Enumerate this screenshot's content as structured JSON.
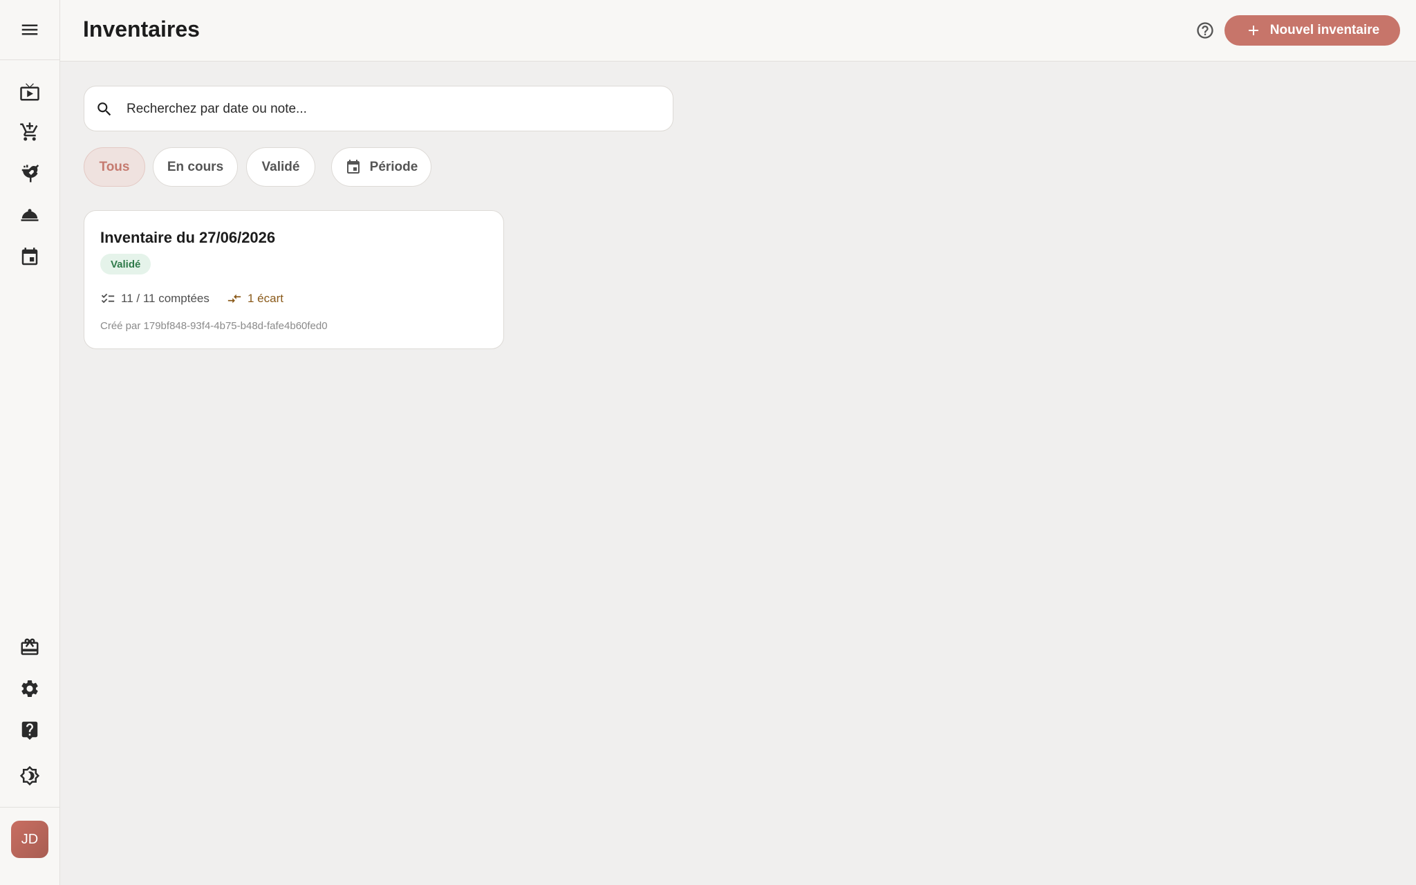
{
  "header": {
    "title": "Inventaires",
    "new_button_label": "Nouvel inventaire"
  },
  "search": {
    "placeholder": "Recherchez par date ou note..."
  },
  "filters": [
    {
      "label": "Tous",
      "active": true
    },
    {
      "label": "En cours",
      "active": false
    },
    {
      "label": "Validé",
      "active": false
    },
    {
      "label": "Période",
      "active": false,
      "icon": "calendar-icon"
    }
  ],
  "sidebar": {
    "menu_icon": "menu-icon",
    "items": [
      {
        "icon": "live-tv-icon"
      },
      {
        "icon": "add-to-cart-icon"
      },
      {
        "icon": "soup-kitchen-icon"
      },
      {
        "icon": "room-service-icon"
      },
      {
        "icon": "event-icon"
      }
    ],
    "bottom_items": [
      {
        "icon": "register-icon"
      },
      {
        "icon": "gear-icon"
      },
      {
        "icon": "help-center-icon"
      },
      {
        "icon": "brightness-icon"
      }
    ],
    "user": {
      "initials": "JD"
    }
  },
  "inventories": [
    {
      "title": "Inventaire du 27/06/2026",
      "status": "Validé",
      "counted": "11 / 11 comptées",
      "gaps": "1 écart",
      "created_by": "Créé par 179bf848-93f4-4b75-b48d-fafe4b60fed0"
    }
  ],
  "colors": {
    "accent": "#c7756a",
    "status_validated_bg": "#e5f3ea",
    "status_validated_fg": "#2f7a4a",
    "gap_color": "#8a5a1a",
    "background": "#f0efee"
  }
}
